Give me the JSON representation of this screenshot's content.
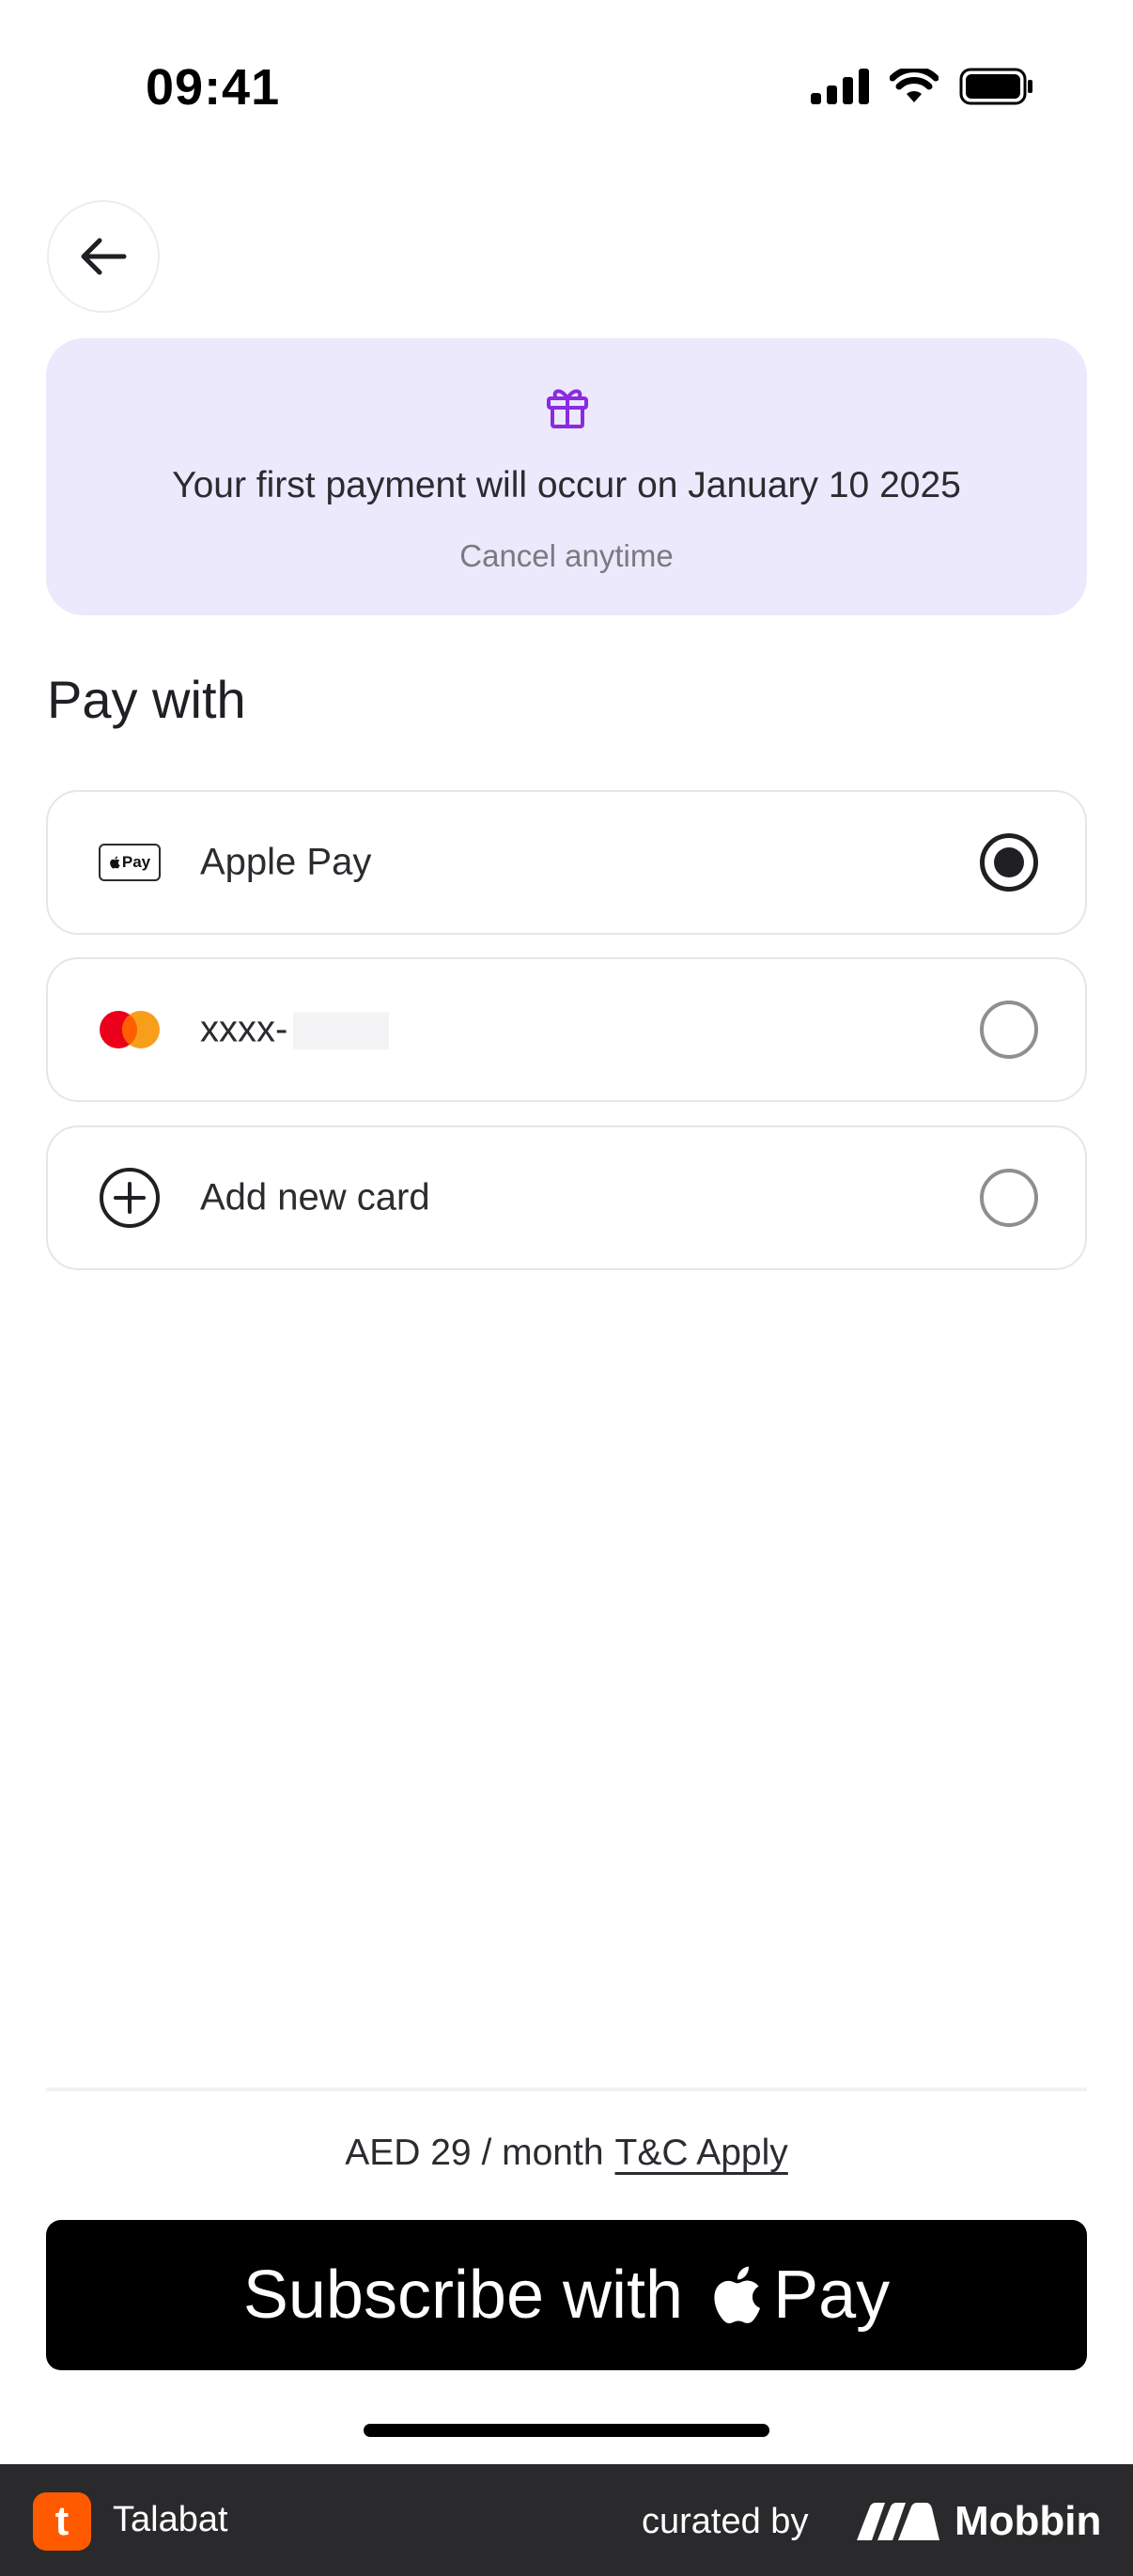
{
  "status_bar": {
    "time": "09:41"
  },
  "banner": {
    "text": "Your first payment will occur on January 10 2025",
    "subtext": "Cancel anytime"
  },
  "pay_with": {
    "title": "Pay with",
    "options": [
      {
        "label": "Apple Pay",
        "badge": "Pay",
        "selected": true
      },
      {
        "label": "xxxx-",
        "selected": false
      },
      {
        "label": "Add new card",
        "selected": false
      }
    ]
  },
  "price": {
    "text": "AED 29 / month",
    "link": "T&C Apply"
  },
  "subscribe_button": {
    "prefix": "Subscribe with",
    "suffix": "Pay"
  },
  "footer": {
    "app_name": "Talabat",
    "logo_letter": "t",
    "curated_by": "curated by",
    "brand": "Mobbin"
  }
}
